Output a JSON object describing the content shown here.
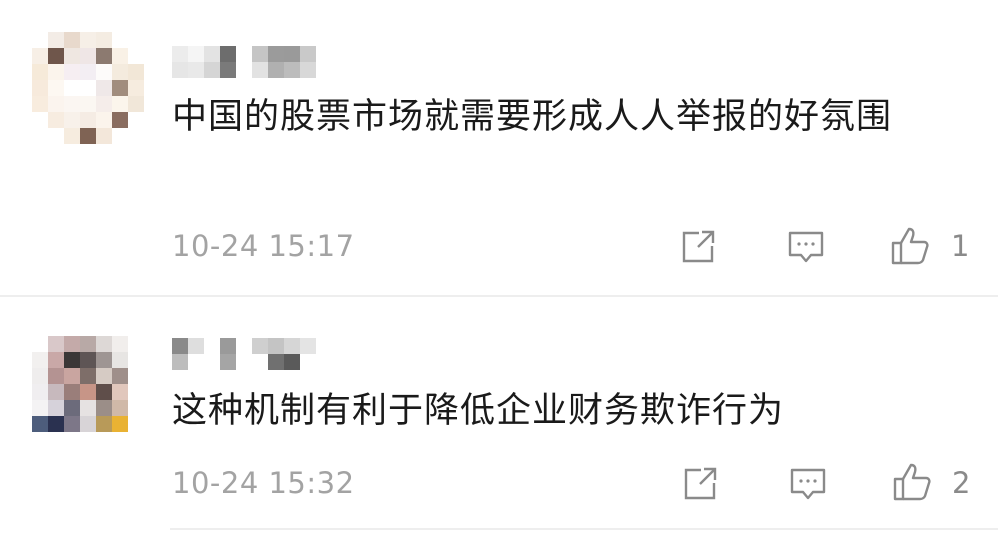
{
  "comments": [
    {
      "text": "中国的股票市场就需要形成人人举报的好氛围",
      "timestamp": "10-24 15:17",
      "like_count": "1"
    },
    {
      "text": "这种机制有利于降低企业财务欺诈行为",
      "timestamp": "10-24 15:32",
      "like_count": "2"
    }
  ],
  "icons": {
    "share": "share-icon",
    "reply": "comment-icon",
    "like": "thumbs-up-icon"
  },
  "colors": {
    "text": "#1a1a1a",
    "meta": "#a3a3a3",
    "icon": "#8a8a8a",
    "divider": "#eeeeee"
  }
}
